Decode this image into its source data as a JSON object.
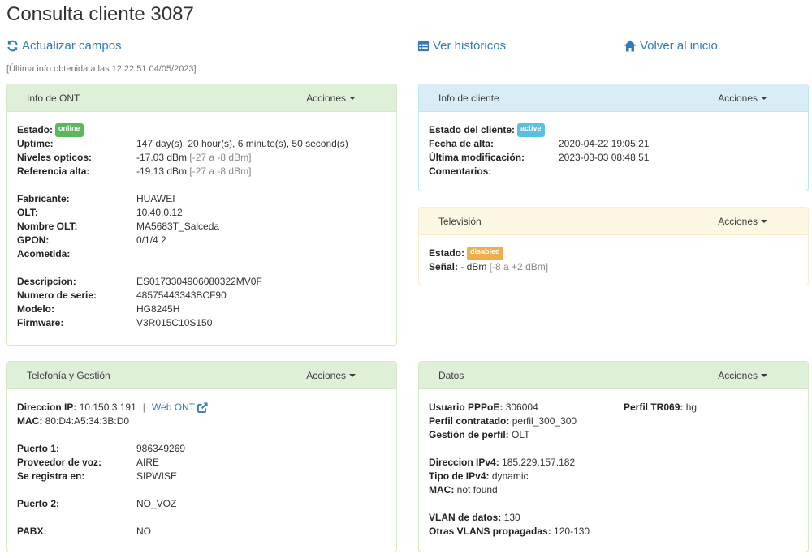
{
  "page": {
    "title": "Consulta cliente 3087"
  },
  "toolbar": {
    "refresh_label": "Actualizar campos",
    "history_label": "Ver históricos",
    "home_label": "Volver al inicio",
    "last_info": "[Última info obtenida a las 12:22:51 04/05/2023]"
  },
  "colors": {
    "link": "#337ab7",
    "online": "#5cb85c",
    "active": "#5bc0de",
    "disabled": "#f0ad4e"
  },
  "ont": {
    "title": "Info de ONT",
    "actions": "Acciones",
    "estado_label": "Estado:",
    "estado_badge": "online",
    "uptime_label": "Uptime:",
    "uptime": "147 day(s), 20 hour(s), 6 minute(s), 50 second(s)",
    "niveles_label": "Niveles opticos:",
    "niveles": "-17.03 dBm",
    "niveles_range": "[-27 a -8 dBm]",
    "referencia_label": "Referencia alta:",
    "referencia": "-19.13 dBm",
    "referencia_range": "[-27 a -8 dBm]",
    "fabricante_label": "Fabricante:",
    "fabricante": "HUAWEI",
    "olt_label": "OLT:",
    "olt": "10.40.0.12",
    "nombre_olt_label": "Nombre OLT:",
    "nombre_olt": "MA5683T_Salceda",
    "gpon_label": "GPON:",
    "gpon": "0/1/4 2",
    "acometida_label": "Acometida:",
    "descripcion_label": "Descripcion:",
    "descripcion": "ES0173304906080322MV0F",
    "serie_label": "Numero de serie:",
    "serie": "48575443343BCF90",
    "modelo_label": "Modelo:",
    "modelo": "HG8245H",
    "firmware_label": "Firmware:",
    "firmware": "V3R015C10S150"
  },
  "cliente": {
    "title": "Info de cliente",
    "actions": "Acciones",
    "estado_label": "Estado del cliente:",
    "estado_badge": "active",
    "alta_label": "Fecha de alta:",
    "alta": "2020-04-22 19:05:21",
    "modif_label": "Última modificación:",
    "modif": "2023-03-03 08:48:51",
    "comentarios_label": "Comentarios:"
  },
  "tv": {
    "title": "Televisión",
    "actions": "Acciones",
    "estado_label": "Estado:",
    "estado_badge": "disabled",
    "senal_label": "Señal:",
    "senal": " - dBm",
    "senal_range": "[-8 a +2 dBm]"
  },
  "telefonia": {
    "title": "Telefonía y Gestión",
    "actions": "Acciones",
    "ip_label": "Direccion IP:",
    "ip": "10.150.3.191",
    "sep": "|",
    "web_ont": "Web ONT",
    "mac_label": "MAC:",
    "mac": "80:D4:A5:34:3B:D0",
    "p1_label": "Puerto 1:",
    "p1": "986349269",
    "proveedor_label": "Proveedor de voz:",
    "proveedor": "AIRE",
    "registra_label": "Se registra en:",
    "registra": "SIPWISE",
    "p2_label": "Puerto 2:",
    "p2": "NO_VOZ",
    "pabx_label": "PABX:",
    "pabx": "NO"
  },
  "datos": {
    "title": "Datos",
    "actions": "Acciones",
    "pppoe_label": "Usuario PPPoE:",
    "pppoe": "306004",
    "tr069_label": "Perfil TR069:",
    "tr069": "hg",
    "perfil_label": "Perfil contratado:",
    "perfil": "perfil_300_300",
    "gestion_label": "Gestión de perfil:",
    "gestion": "OLT",
    "ipv4_label": "Direccion IPv4:",
    "ipv4": "185.229.157.182",
    "tipo_label": "Tipo de IPv4:",
    "tipo": "dynamic",
    "mac_label": "MAC:",
    "mac": "not found",
    "vlan_label": "VLAN de datos:",
    "vlan": "130",
    "otras_label": "Otras VLANS propagadas:",
    "otras": "120-130"
  }
}
